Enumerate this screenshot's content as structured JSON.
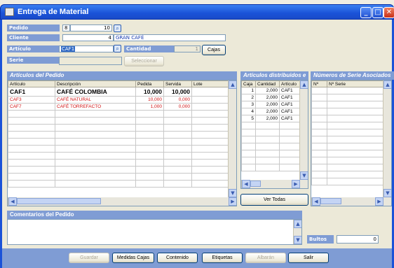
{
  "window": {
    "title": "Entrega de Material"
  },
  "form": {
    "pedido_label": "Pedido",
    "pedido_serie": "8",
    "pedido_num": "10",
    "cliente_label": "Cliente",
    "cliente_code": "4",
    "cliente_name": "GRAN CAFÉ",
    "articulo_label": "Artículo",
    "articulo_value": "CAF1",
    "cantidad_label": "Cantidad",
    "cantidad_value": "1",
    "cajas_button": "Cajas",
    "serie_label": "Serie",
    "seleccionar_button": "Seleccionar"
  },
  "articulos": {
    "title": "Artículos del Pedido",
    "columns": [
      "Artículo",
      "Descripción",
      "Pedida",
      "Servida",
      "Lote"
    ],
    "rows": [
      {
        "art": "CAF1",
        "desc": "CAFÉ COLOMBIA",
        "pedida": "10,000",
        "servida": "10,000",
        "lote": ""
      },
      {
        "art": "CAF3",
        "desc": "CAFÉ NATURAL",
        "pedida": "10,000",
        "servida": "0,000",
        "lote": ""
      },
      {
        "art": "CAF7",
        "desc": "CAFÉ TORREFACTO",
        "pedida": "1,000",
        "servida": "0,000",
        "lote": ""
      }
    ]
  },
  "distribuidos": {
    "title": "Artículos distribuidos e",
    "columns": [
      "Caja",
      "Cantidad",
      "Artículo"
    ],
    "rows": [
      {
        "caja": "1",
        "cantidad": "2,000",
        "art": "CAF1"
      },
      {
        "caja": "2",
        "cantidad": "2,000",
        "art": "CAF1"
      },
      {
        "caja": "3",
        "cantidad": "2,000",
        "art": "CAF1"
      },
      {
        "caja": "4",
        "cantidad": "2,000",
        "art": "CAF1"
      },
      {
        "caja": "5",
        "cantidad": "2,000",
        "art": "CAF1"
      }
    ],
    "ver_todas": "Ver Todas"
  },
  "series": {
    "title": "Números de Serie Asociados",
    "columns": [
      "Nº",
      "Nº Serie"
    ]
  },
  "comentarios": {
    "title": "Comentarios del Pedido"
  },
  "bultos": {
    "label": "Bultos",
    "value": "0"
  },
  "buttons": {
    "guardar": "Guardar",
    "medidas": "Medidas Cajas",
    "contenido": "Contenido",
    "etiquetas": "Etiquetas",
    "albaran": "Albarán",
    "salir": "Salir"
  },
  "colors": {
    "title_bar": "#1a52d8",
    "section_header": "#7f9cd4",
    "highlight_row": "#d01010"
  }
}
